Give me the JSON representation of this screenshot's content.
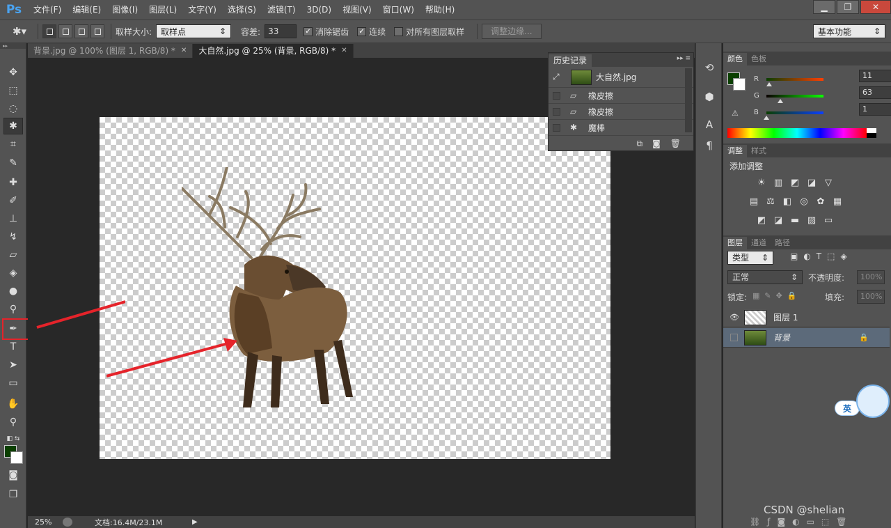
{
  "app": {
    "logo": "Ps",
    "menu": [
      "文件(F)",
      "编辑(E)",
      "图像(I)",
      "图层(L)",
      "文字(Y)",
      "选择(S)",
      "滤镜(T)",
      "3D(D)",
      "视图(V)",
      "窗口(W)",
      "帮助(H)"
    ],
    "window_controls": [
      "▁",
      "❐",
      "✕"
    ]
  },
  "options": {
    "sample_size_label": "取样大小:",
    "sample_size_value": "取样点",
    "tolerance_label": "容差:",
    "tolerance_value": "33",
    "antialias_label": "消除锯齿",
    "contiguous_label": "连续",
    "all_layers_label": "对所有图层取样",
    "refine_edge_label": "调整边缘...",
    "workspace_value": "基本功能"
  },
  "tabs": [
    {
      "label": "背景.jpg @ 100% (图层 1, RGB/8) *"
    },
    {
      "label": "大自然.jpg @ 25% (背景, RGB/8) *"
    }
  ],
  "status": {
    "zoom": "25%",
    "doc_info": "文档:16.4M/23.1M",
    "arrow": "▶"
  },
  "history": {
    "tab_label": "历史记录",
    "snapshot_label": "大自然.jpg",
    "items": [
      "橡皮擦",
      "橡皮擦",
      "魔棒"
    ],
    "icon_names": [
      "eraser-icon",
      "eraser-icon",
      "magic-wand-icon"
    ]
  },
  "color_panel": {
    "tabs": [
      "颜色",
      "色板"
    ],
    "channels": [
      {
        "letter": "R",
        "value": "11",
        "level": 0.043
      },
      {
        "letter": "G",
        "value": "63",
        "level": 0.247
      },
      {
        "letter": "B",
        "value": "1",
        "level": 0.004
      }
    ],
    "foreground": "#0b3f01",
    "background": "#ffffff"
  },
  "adjustments_panel": {
    "tabs": [
      "调整",
      "样式"
    ],
    "add_label": "添加调整",
    "row1": [
      "☀",
      "▥",
      "◩",
      "◪",
      "▽"
    ],
    "row2": [
      "▤",
      "⚖",
      "◧",
      "◎",
      "✿",
      "▦"
    ],
    "row3": [
      "◩",
      "◪",
      "▬",
      "▨",
      "▭"
    ]
  },
  "layers_panel": {
    "tabs": [
      "图层",
      "通道",
      "路径"
    ],
    "filter_type": "类型",
    "blend_mode": "正常",
    "opacity_label": "不透明度:",
    "opacity_value": "100%",
    "lock_label": "锁定:",
    "fill_label": "填充:",
    "fill_value": "100%",
    "layers": [
      {
        "name": "图层 1",
        "visible": true,
        "selected": false,
        "locked": false
      },
      {
        "name": "背景",
        "visible": false,
        "selected": true,
        "locked": true
      }
    ]
  },
  "overlay": {
    "ime_label": "英",
    "watermark": "CSDN @shelian"
  }
}
